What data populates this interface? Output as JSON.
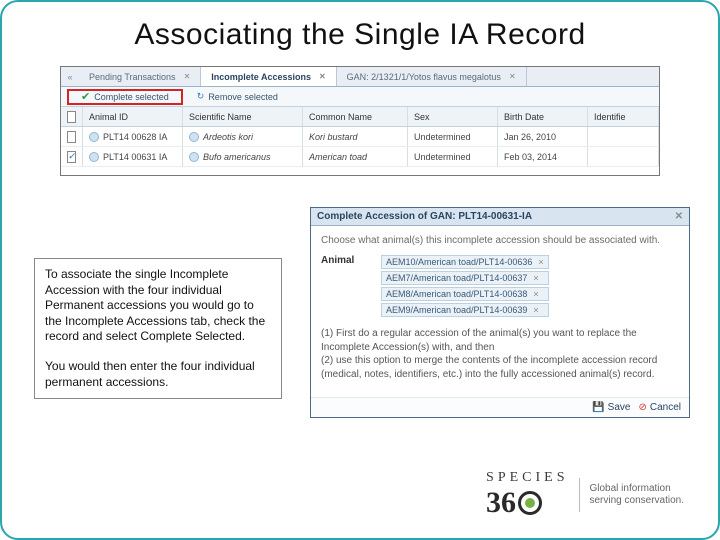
{
  "title": "Associating the Single IA Record",
  "grid": {
    "tabs": {
      "pending": "Pending Transactions",
      "incomplete": "Incomplete Accessions",
      "gan": "GAN: 2/1321/1/Yotos flavus megalotus"
    },
    "toolbar": {
      "complete": "Complete selected",
      "remove": "Remove selected"
    },
    "headers": {
      "animal_id": "Animal ID",
      "scientific": "Scientific Name",
      "common": "Common Name",
      "sex": "Sex",
      "birth": "Birth Date",
      "identifier": "Identifie"
    },
    "rows": [
      {
        "checked": false,
        "id": "PLT14 00628 IA",
        "sci": "Ardeotis kori",
        "com": "Kori bustard",
        "sex": "Undetermined",
        "bd": "Jan 26, 2010"
      },
      {
        "checked": true,
        "id": "PLT14 00631 IA",
        "sci": "Bufo americanus",
        "com": "American toad",
        "sex": "Undetermined",
        "bd": "Feb 03, 2014"
      }
    ]
  },
  "instructions": {
    "p1": "To associate the single Incomplete Accession with the four individual Permanent accessions you would go to the Incomplete Accessions tab, check the record and select Complete Selected.",
    "p2": "You would then enter the four individual permanent accessions."
  },
  "dialog": {
    "title": "Complete Accession of GAN: PLT14-00631-IA",
    "desc": "Choose what animal(s) this incomplete accession should be associated with.",
    "animal_label": "Animal",
    "tags": [
      "AEM10/American toad/PLT14-00636",
      "AEM7/American toad/PLT14-00637",
      "AEM8/American toad/PLT14-00638",
      "AEM9/American toad/PLT14-00639"
    ],
    "step1": "(1) First do a regular accession of the animal(s) you want to replace the Incomplete Accession(s) with, and then",
    "step2": "(2) use this option to merge the contents of the incomplete accession record (medical, notes, identifiers, etc.) into the fully accessioned animal(s) record.",
    "save": "Save",
    "cancel": "Cancel"
  },
  "footer": {
    "brand_letters": "SPECIES",
    "tagline1": "Global information",
    "tagline2": "serving conservation."
  }
}
